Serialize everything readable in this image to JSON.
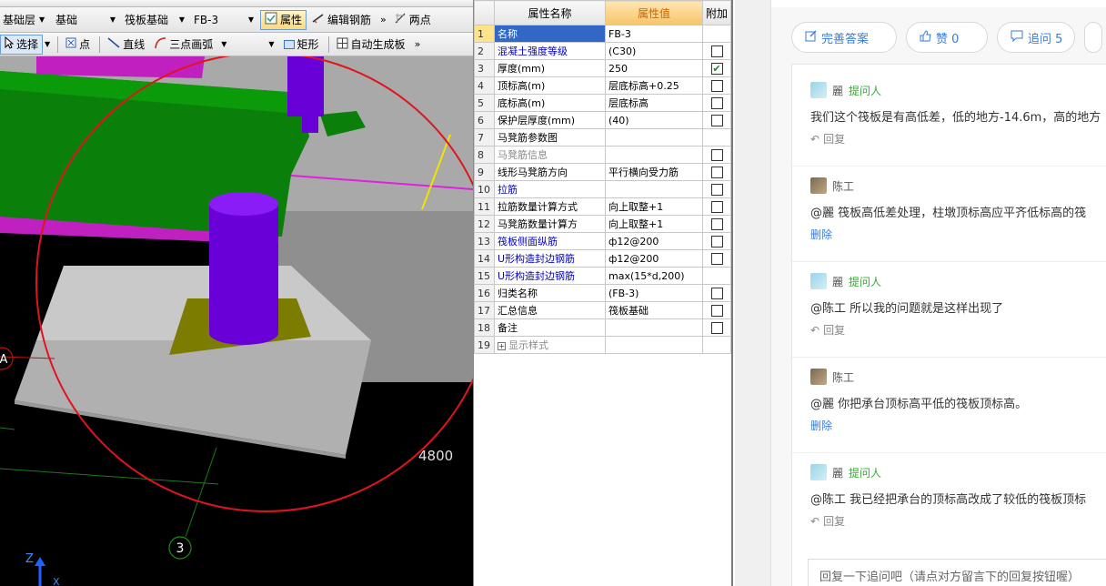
{
  "cad": {
    "toolbar1": {
      "layer_value": "基础层",
      "category_value": "基础",
      "component_type_value": "筏板基础",
      "component_name_value": "FB-3",
      "properties_label": "属性",
      "edit_rebar_label": "编辑钢筋",
      "two_point_label": "两点"
    },
    "toolbar2": {
      "select_label": "选择",
      "point_label": "点",
      "line_label": "直线",
      "arc_label": "三点画弧",
      "rect_label": "矩形",
      "auto_slab_label": "自动生成板"
    },
    "viewport": {
      "dimension_text": "4800",
      "axis_3_label": "3",
      "axis_a_label": "A",
      "axis_z_label": "Z",
      "axis_x_label": "X"
    }
  },
  "props": {
    "header": {
      "name_col": "属性名称",
      "value_col": "属性值",
      "extra_col": "附加"
    },
    "rows": [
      {
        "num": "1",
        "name": "名称",
        "value": "FB-3",
        "check": null,
        "style": "selected"
      },
      {
        "num": "2",
        "name": "混凝土强度等级",
        "value": "(C30)",
        "check": false,
        "style": "blue"
      },
      {
        "num": "3",
        "name": "厚度(mm)",
        "value": "250",
        "check": true,
        "style": "normal"
      },
      {
        "num": "4",
        "name": "顶标高(m)",
        "value": "层底标高+0.25",
        "check": false,
        "style": "normal"
      },
      {
        "num": "5",
        "name": "底标高(m)",
        "value": "层底标高",
        "check": false,
        "style": "normal"
      },
      {
        "num": "6",
        "name": "保护层厚度(mm)",
        "value": "(40)",
        "check": false,
        "style": "normal"
      },
      {
        "num": "7",
        "name": "马凳筋参数图",
        "value": "",
        "check": null,
        "style": "normal"
      },
      {
        "num": "8",
        "name": "马凳筋信息",
        "value": "",
        "check": false,
        "style": "gray"
      },
      {
        "num": "9",
        "name": "线形马凳筋方向",
        "value": "平行横向受力筋",
        "check": false,
        "style": "normal"
      },
      {
        "num": "10",
        "name": "拉筋",
        "value": "",
        "check": false,
        "style": "blue"
      },
      {
        "num": "11",
        "name": "拉筋数量计算方式",
        "value": "向上取整+1",
        "check": false,
        "style": "normal"
      },
      {
        "num": "12",
        "name": "马凳筋数量计算方",
        "value": "向上取整+1",
        "check": false,
        "style": "normal"
      },
      {
        "num": "13",
        "name": "筏板侧面纵筋",
        "value": "ф12@200",
        "check": false,
        "style": "blue"
      },
      {
        "num": "14",
        "name": "U形构造封边钢筋",
        "value": "ф12@200",
        "check": false,
        "style": "blue"
      },
      {
        "num": "15",
        "name": "U形构造封边钢筋",
        "value": "max(15*d,200)",
        "check": null,
        "style": "blue"
      },
      {
        "num": "16",
        "name": "归类名称",
        "value": "(FB-3)",
        "check": false,
        "style": "normal"
      },
      {
        "num": "17",
        "name": "汇总信息",
        "value": "筏板基础",
        "check": false,
        "style": "normal"
      },
      {
        "num": "18",
        "name": "备注",
        "value": "",
        "check": false,
        "style": "normal"
      },
      {
        "num": "19",
        "name": "显示样式",
        "value": "",
        "check": null,
        "style": "group"
      }
    ]
  },
  "qa": {
    "buttons": {
      "improve_label": "完善答案",
      "like_label": "赞 0",
      "followup_label": "追问 5"
    },
    "comments": [
      {
        "user": "麗",
        "role": "提问人",
        "avatar": "asker",
        "text": "我们这个筏板是有高低差，低的地方-14.6m，高的地方",
        "action": "回复"
      },
      {
        "user": "陈工",
        "role": "",
        "avatar": "expert",
        "text": "@麗 筏板高低差处理，柱墩顶标高应平齐低标高的筏",
        "action": "删除"
      },
      {
        "user": "麗",
        "role": "提问人",
        "avatar": "asker",
        "text": "@陈工 所以我的问题就是这样出现了",
        "action": "回复"
      },
      {
        "user": "陈工",
        "role": "",
        "avatar": "expert",
        "text": "@麗 你把承台顶标高平低的筏板顶标高。",
        "action": "删除"
      },
      {
        "user": "麗",
        "role": "提问人",
        "avatar": "asker",
        "text": "@陈工 我已经把承台的顶标高改成了较低的筏板顶标",
        "action": "回复"
      }
    ],
    "reply_placeholder": "回复一下追问吧（请点对方留言下的回复按钮喔）"
  }
}
